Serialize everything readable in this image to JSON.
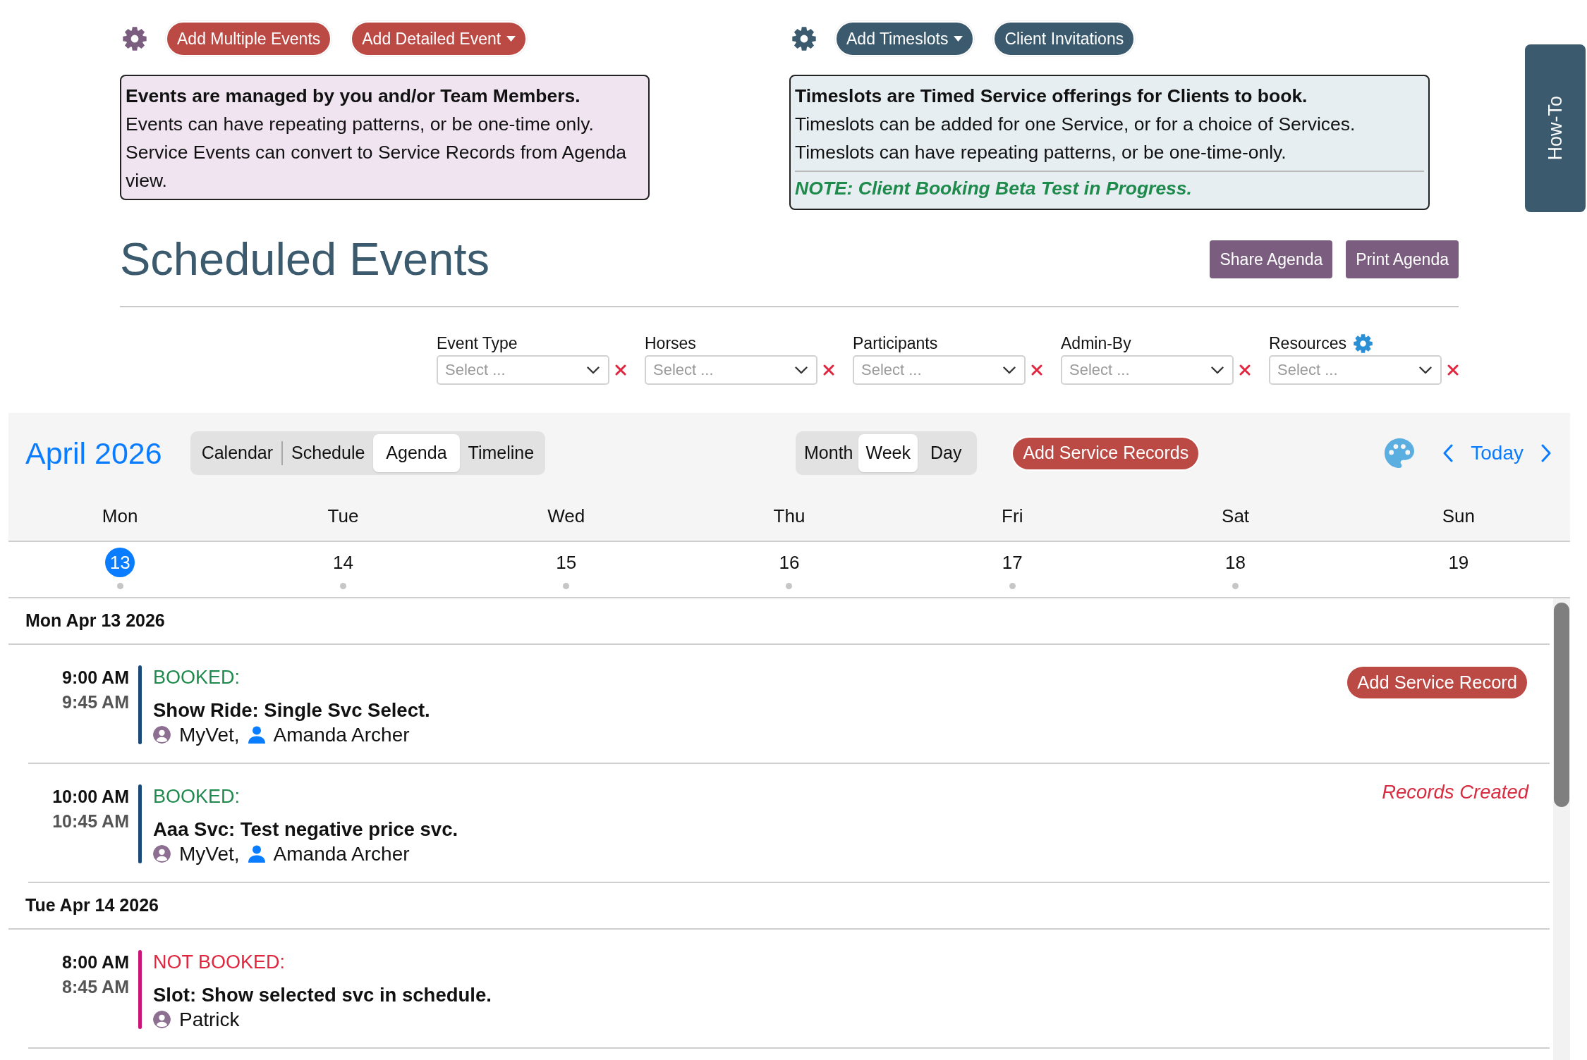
{
  "events_section": {
    "buttons": [
      {
        "label": "Add Multiple Events",
        "dropdown": false
      },
      {
        "label": "Add Detailed Event",
        "dropdown": true
      }
    ],
    "info": {
      "title": "Events are managed by you and/or Team Members.",
      "lines": [
        "Events can have repeating patterns, or be one-time only.",
        "Service Events can convert to Service Records from Agenda view."
      ]
    }
  },
  "timeslots_section": {
    "buttons": [
      {
        "label": "Add Timeslots",
        "dropdown": true
      },
      {
        "label": "Client Invitations",
        "dropdown": false
      }
    ],
    "info": {
      "title": "Timeslots are Timed Service offerings for Clients to book.",
      "lines": [
        "Timeslots can be added for one Service, or for a choice of Services.",
        "Timeslots can have repeating patterns, or be one-time-only."
      ],
      "note": "NOTE: Client Booking Beta Test in Progress."
    }
  },
  "side_tab": {
    "label": "How-To"
  },
  "page_title": "Scheduled Events",
  "header_buttons": [
    "Share Agenda",
    "Print Agenda"
  ],
  "filters": [
    {
      "label": "Event Type",
      "placeholder": "Select ...",
      "settings_icon": false
    },
    {
      "label": "Horses",
      "placeholder": "Select ...",
      "settings_icon": false
    },
    {
      "label": "Participants",
      "placeholder": "Select ...",
      "settings_icon": false
    },
    {
      "label": "Admin-By",
      "placeholder": "Select ...",
      "settings_icon": false
    },
    {
      "label": "Resources",
      "placeholder": "Select ...",
      "settings_icon": true
    }
  ],
  "calendar": {
    "title": "April 2026",
    "views": [
      {
        "label": "Calendar",
        "selected": false
      },
      {
        "label": "Schedule",
        "selected": false
      },
      {
        "label": "Agenda",
        "selected": true
      },
      {
        "label": "Timeline",
        "selected": false
      }
    ],
    "ranges": [
      {
        "label": "Month",
        "selected": false
      },
      {
        "label": "Week",
        "selected": true
      },
      {
        "label": "Day",
        "selected": false
      }
    ],
    "action_button": "Add Service Records",
    "today_button": "Today",
    "days": [
      {
        "weekday": "Mon",
        "date": "13",
        "selected": true,
        "has_events": true
      },
      {
        "weekday": "Tue",
        "date": "14",
        "selected": false,
        "has_events": true
      },
      {
        "weekday": "Wed",
        "date": "15",
        "selected": false,
        "has_events": true
      },
      {
        "weekday": "Thu",
        "date": "16",
        "selected": false,
        "has_events": true
      },
      {
        "weekday": "Fri",
        "date": "17",
        "selected": false,
        "has_events": true
      },
      {
        "weekday": "Sat",
        "date": "18",
        "selected": false,
        "has_events": true
      },
      {
        "weekday": "Sun",
        "date": "19",
        "selected": false,
        "has_events": false
      }
    ]
  },
  "agenda": [
    {
      "heading": "Mon Apr 13 2026",
      "events": [
        {
          "start": "9:00 AM",
          "end": "9:45 AM",
          "booked": true,
          "status": "BOOKED:",
          "color": "#1b4a78",
          "title": "Show Ride: Single Svc Select.",
          "people": [
            {
              "kind": "contact",
              "name": "MyVet,"
            },
            {
              "kind": "user",
              "name": "Amanda Archer"
            }
          ],
          "action": {
            "kind": "button",
            "label": "Add Service Record"
          }
        },
        {
          "start": "10:00 AM",
          "end": "10:45 AM",
          "booked": true,
          "status": "BOOKED:",
          "color": "#1b4a78",
          "title": "Aaa Svc: Test negative price svc.",
          "people": [
            {
              "kind": "contact",
              "name": "MyVet,"
            },
            {
              "kind": "user",
              "name": "Amanda Archer"
            }
          ],
          "action": {
            "kind": "note",
            "label": "Records Created"
          }
        }
      ]
    },
    {
      "heading": "Tue Apr 14 2026",
      "events": [
        {
          "start": "8:00 AM",
          "end": "8:45 AM",
          "booked": false,
          "status": "NOT BOOKED:",
          "color": "#cc1477",
          "title": "Slot: Show selected svc in schedule.",
          "people": [
            {
              "kind": "contact",
              "name": "Patrick"
            }
          ]
        }
      ]
    }
  ]
}
